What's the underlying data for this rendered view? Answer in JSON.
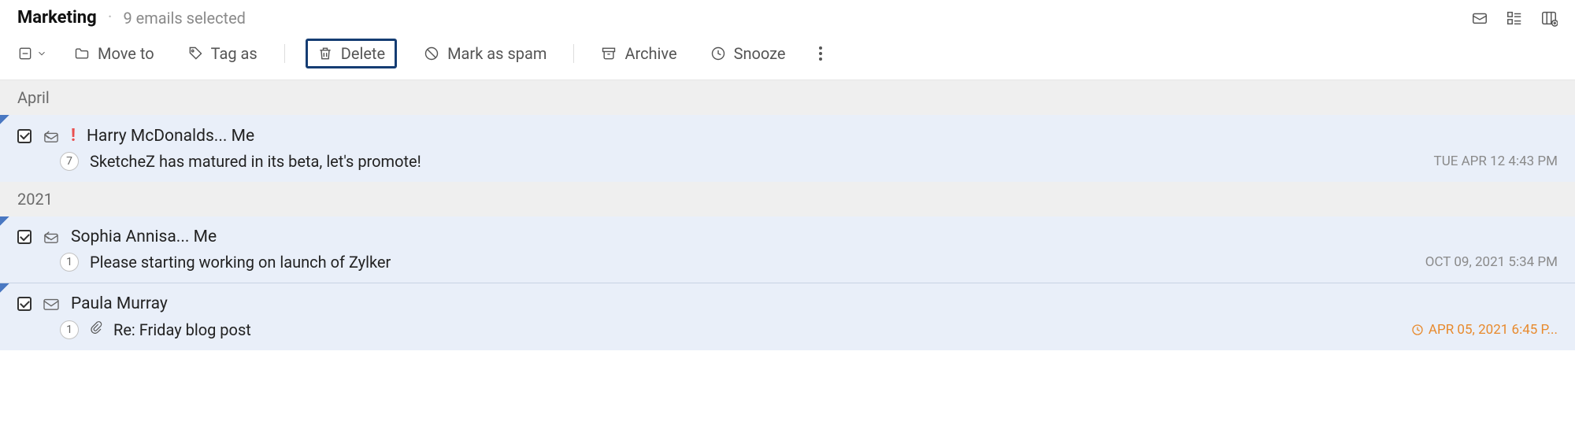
{
  "header": {
    "folder_name": "Marketing",
    "selection_text": "9 emails selected"
  },
  "toolbar": {
    "move_to": "Move to",
    "tag_as": "Tag as",
    "delete": "Delete",
    "mark_spam": "Mark as spam",
    "archive": "Archive",
    "snooze": "Snooze"
  },
  "groups": [
    {
      "label": "April",
      "emails": [
        {
          "checked": true,
          "reply_icon": true,
          "priority": true,
          "sender": "Harry McDonalds... Me",
          "count": "7",
          "subject": "SketcheZ has matured in its beta, let's promote!",
          "timestamp": "TUE APR 12 4:43 PM",
          "snoozed": false,
          "attachment": false
        }
      ]
    },
    {
      "label": "2021",
      "emails": [
        {
          "checked": true,
          "reply_icon": true,
          "priority": false,
          "sender": "Sophia Annisa... Me",
          "count": "1",
          "subject": "Please starting working on launch of Zylker",
          "timestamp": "OCT 09, 2021 5:34 PM",
          "snoozed": false,
          "attachment": false
        },
        {
          "checked": true,
          "reply_icon": false,
          "priority": false,
          "sender": "Paula Murray",
          "count": "1",
          "subject": "Re: Friday blog post",
          "timestamp": "APR 05, 2021 6:45 P...",
          "snoozed": true,
          "attachment": true
        }
      ]
    }
  ]
}
